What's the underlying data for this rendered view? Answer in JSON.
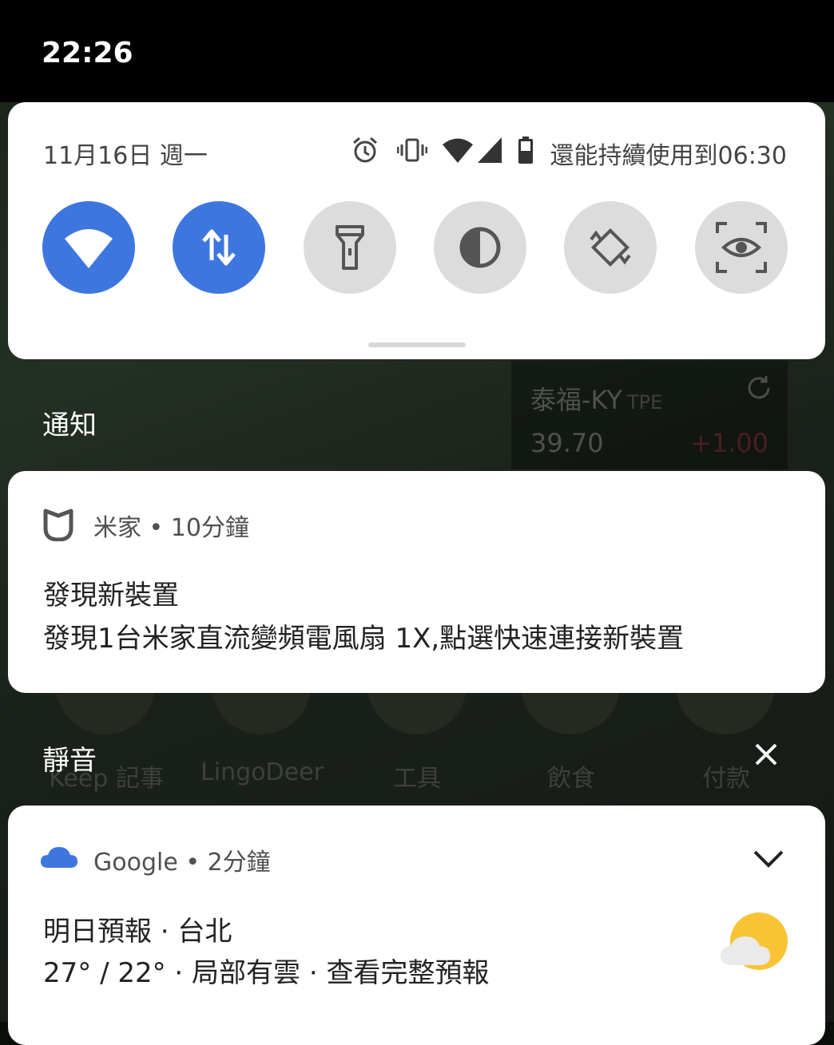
{
  "status_bar": {
    "time": "22:26"
  },
  "quick_settings": {
    "date": "11月16日 週一",
    "status_icons": [
      "alarm-icon",
      "vibrate-icon",
      "wifi-signal-icon",
      "cell-signal-icon",
      "battery-icon"
    ],
    "battery_text": "還能持續使用到06:30",
    "tiles": [
      {
        "icon": "wifi-icon",
        "state": "on"
      },
      {
        "icon": "mobile-data-icon",
        "state": "on"
      },
      {
        "icon": "flashlight-icon",
        "state": "off"
      },
      {
        "icon": "invert-colors-icon",
        "state": "off"
      },
      {
        "icon": "auto-rotate-icon",
        "state": "off"
      },
      {
        "icon": "screen-attention-icon",
        "state": "off"
      }
    ],
    "accent_color": "#3e76e0",
    "inactive_color": "#dcdcdc"
  },
  "background_widgets": {
    "stock": {
      "name": "泰福-KY",
      "exchange": "TPE",
      "price": "39.70",
      "change": "+1.00"
    },
    "apps": [
      "Keep 記事",
      "LingoDeer",
      "工具",
      "飲食",
      "付款"
    ]
  },
  "notifications_header": "通知",
  "mijia_notification": {
    "app_icon": "mijia-icon",
    "app": "米家",
    "time": "10分鐘",
    "title": "發現新裝置",
    "body": "發現1台米家直流變頻電風扇 1X,點選快速連接新裝置"
  },
  "silent_header": "靜音",
  "google_notification": {
    "app_icon": "cloud-icon",
    "app": "Google",
    "time": "2分鐘",
    "title": "明日預報 · 台北",
    "body": "27° / 22° · 局部有雲 · 查看完整預報",
    "weather_icon": "partly-cloudy-icon"
  }
}
